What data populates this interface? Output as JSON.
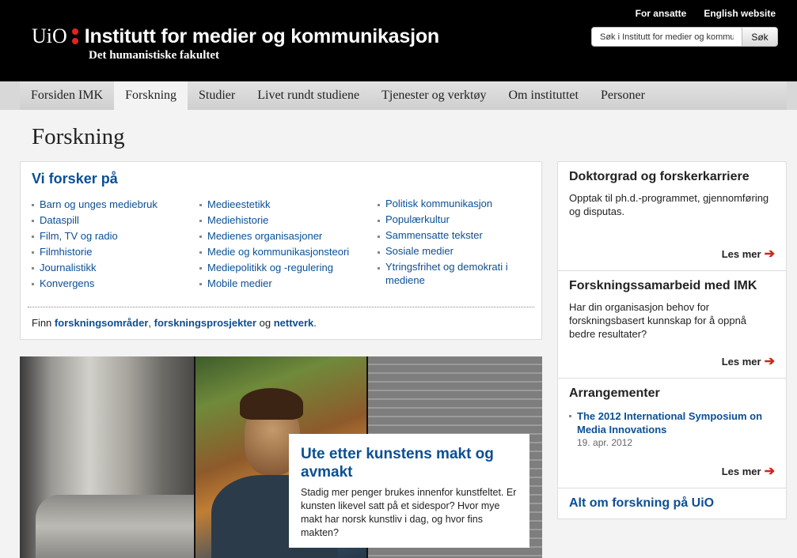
{
  "header": {
    "top_links": [
      "For ansatte",
      "English website"
    ],
    "logo_text": "UiO",
    "site_title": "Institutt for medier og kommunikasjon",
    "faculty": "Det humanistiske fakultet",
    "search_placeholder": "Søk i Institutt for medier og kommunikasjon",
    "search_button": "Søk"
  },
  "nav": {
    "tabs": [
      "Forsiden IMK",
      "Forskning",
      "Studier",
      "Livet rundt studiene",
      "Tjenester og verktøy",
      "Om instituttet",
      "Personer"
    ],
    "active": "Forskning"
  },
  "page_title": "Forskning",
  "research": {
    "heading": "Vi forsker på",
    "col1": [
      "Barn og unges mediebruk",
      "Dataspill",
      "Film, TV og radio",
      "Filmhistorie",
      "Journalistikk",
      "Konvergens"
    ],
    "col2": [
      "Medieestetikk",
      "Mediehistorie",
      "Medienes organisasjoner",
      "Medie og kommunikasjonsteori",
      "Mediepolitikk og -regulering",
      "Mobile medier"
    ],
    "col3": [
      "Politisk kommunikasjon",
      "Populærkultur",
      "Sammensatte tekster",
      "Sosiale medier",
      "Ytringsfrihet og demokrati i mediene"
    ],
    "find_prefix": "Finn",
    "find_link1": "forskningsområder",
    "find_sep1": ",",
    "find_link2": "forskningsprosjekter",
    "find_and": "og",
    "find_link3": "nettverk",
    "find_suffix": "."
  },
  "feature": {
    "title": "Ute etter kunstens makt og avmakt",
    "text": "Stadig mer penger brukes innenfor kunstfeltet. Er kunsten likevel satt på et sidespor? Hvor mye makt har norsk kunstliv i dag, og hvor fins makten?"
  },
  "sidebar": {
    "box1": {
      "title": "Doktorgrad og forskerkarriere",
      "text": "Opptak til ph.d.-programmet, gjennomføring og disputas.",
      "more": "Les mer"
    },
    "box2": {
      "title": "Forskningssamarbeid med IMK",
      "text": "Har din organisasjon behov for forskningsbasert kunnskap for å oppnå bedre resultater?",
      "more": "Les mer"
    },
    "box3": {
      "title": "Arrangementer",
      "event_title": "The 2012 International Symposium on Media Innovations",
      "event_date": "19. apr. 2012",
      "more": "Les mer"
    },
    "all_link": "Alt om forskning på UiO"
  },
  "colors": {
    "link": "#0b4f94",
    "arrow": "#d0261c",
    "uio_red": "#e0251b"
  }
}
